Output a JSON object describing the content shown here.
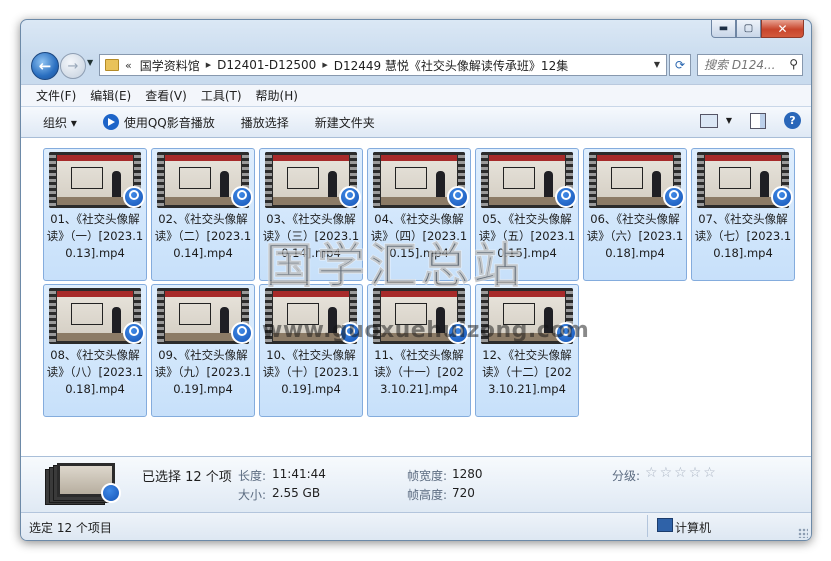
{
  "breadcrumb": {
    "items": [
      "国学资料馆",
      "D12401-D12500",
      "D12449 慧悦《社交头像解读传承班》12集"
    ]
  },
  "search": {
    "placeholder": "搜索 D124..."
  },
  "menu": [
    "文件(F)",
    "编辑(E)",
    "查看(V)",
    "工具(T)",
    "帮助(H)"
  ],
  "commands": {
    "organize": "组织 ▾",
    "play_qq": "使用QQ影音播放",
    "play_select": "播放选择",
    "new_folder": "新建文件夹"
  },
  "files": [
    {
      "name": "01、《社交头像解读》（一）[2023.10.13].mp4"
    },
    {
      "name": "02、《社交头像解读》（二）[2023.10.14].mp4"
    },
    {
      "name": "03、《社交头像解读》（三）[2023.10.14].mp4"
    },
    {
      "name": "04、《社交头像解读》（四）[2023.10.15].mp4"
    },
    {
      "name": "05、《社交头像解读》（五）[2023.10.15].mp4"
    },
    {
      "name": "06、《社交头像解读》（六）[2023.10.18].mp4"
    },
    {
      "name": "07、《社交头像解读》（七）[2023.10.18].mp4"
    },
    {
      "name": "08、《社交头像解读》（八）[2023.10.18].mp4"
    },
    {
      "name": "09、《社交头像解读》（九）[2023.10.19].mp4"
    },
    {
      "name": "10、《社交头像解读》（十）[2023.10.19].mp4"
    },
    {
      "name": "11、《社交头像解读》（十一）[2023.10.21].mp4"
    },
    {
      "name": "12、《社交头像解读》（十二）[2023.10.21].mp4"
    }
  ],
  "watermark": {
    "title": "国学汇总站",
    "url": "www.guoxuehuizong.com"
  },
  "details": {
    "selected": "已选择 12 个项",
    "length_label": "长度:",
    "length": "11:41:44",
    "size_label": "大小:",
    "size": "2.55 GB",
    "frame_width_label": "帧宽度:",
    "frame_width": "1280",
    "frame_height_label": "帧高度:",
    "frame_height": "720",
    "rating_label": "分级:"
  },
  "status": {
    "left": "选定 12 个项目",
    "right": "计算机"
  },
  "colors": {
    "accent": "#1554b6",
    "selection": "#c7e0fa",
    "close": "#c8452c"
  }
}
